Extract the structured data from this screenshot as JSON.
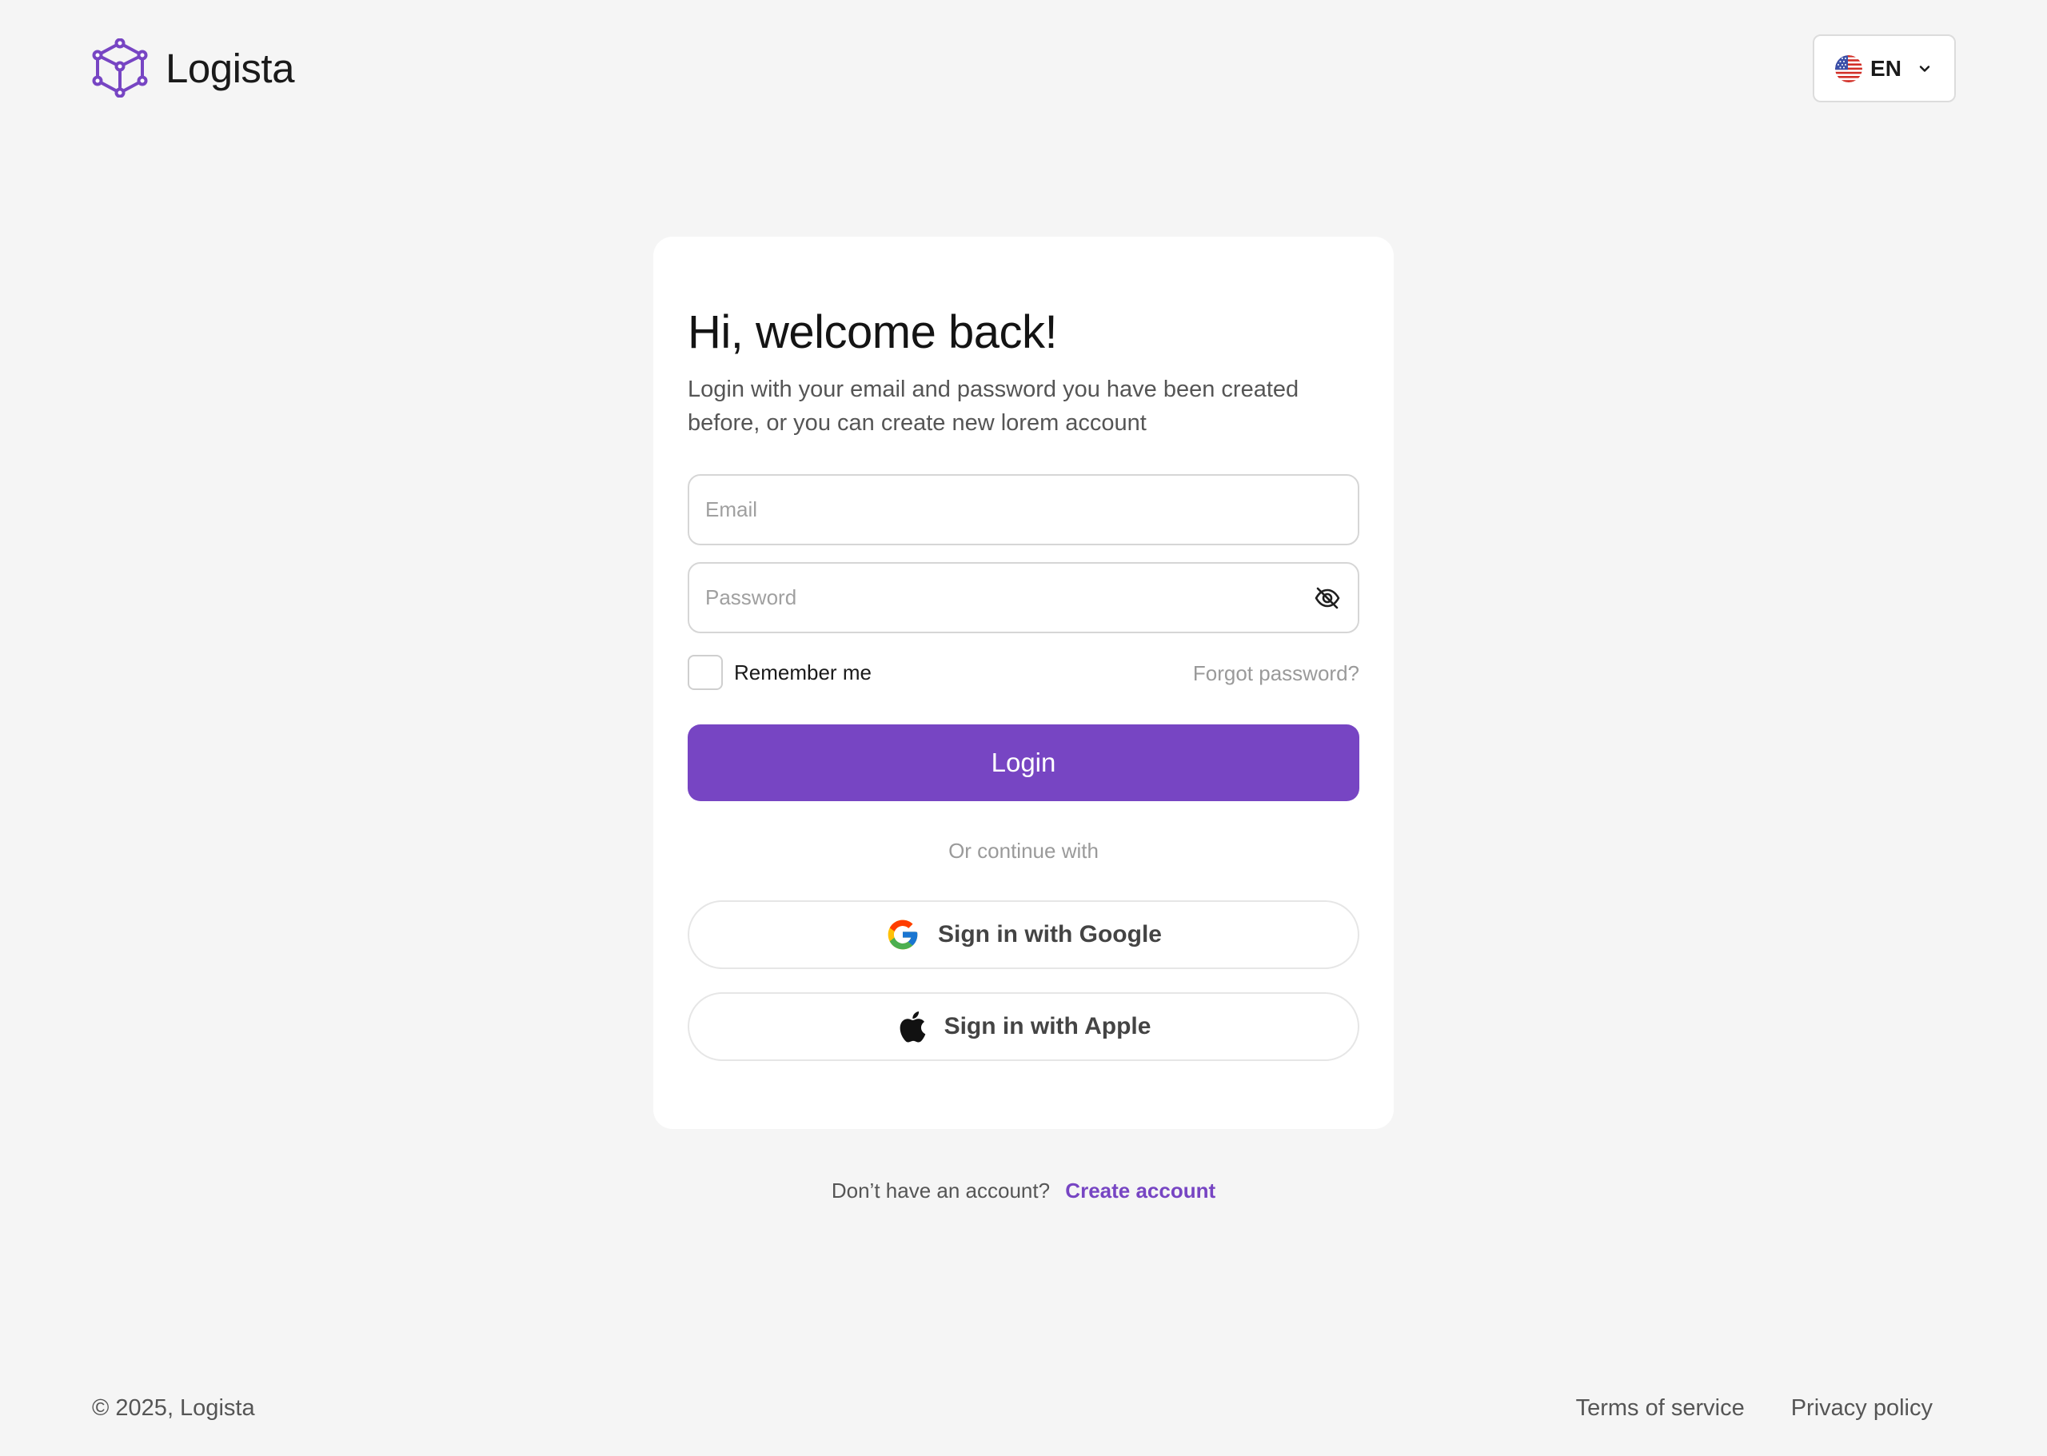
{
  "brand": {
    "name": "Logista",
    "accent_color": "#7745c3"
  },
  "header": {
    "language": {
      "code": "EN",
      "flag": "us-flag-icon"
    }
  },
  "login_card": {
    "title": "Hi, welcome back!",
    "subtitle": "Login with your email and password you have been created before, or you can create new lorem account",
    "email_placeholder": "Email",
    "email_value": "",
    "password_placeholder": "Password",
    "password_value": "",
    "remember_me_label": "Remember me",
    "remember_me_checked": false,
    "forgot_password_label": "Forgot password?",
    "login_button_label": "Login",
    "divider_text": "Or continue with",
    "google_button_label": "Sign in with Google",
    "apple_button_label": "Sign in with Apple"
  },
  "signup": {
    "question": "Don’t have an account?",
    "link_label": "Create account"
  },
  "footer": {
    "copyright": "© 2025, Logista",
    "terms_label": "Terms of service",
    "privacy_label": "Privacy policy"
  }
}
